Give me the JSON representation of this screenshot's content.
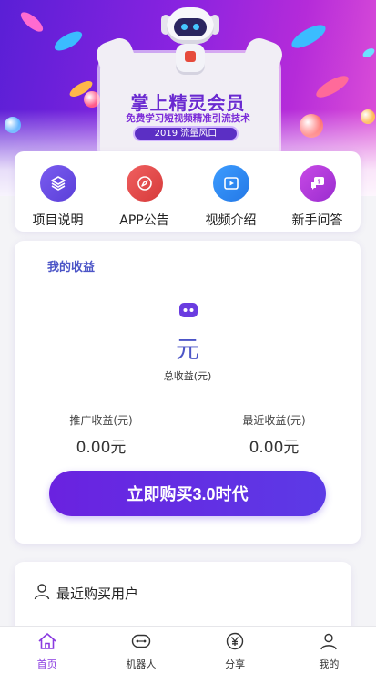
{
  "banner": {
    "title": "掌上精灵会员",
    "subtitle": "免费学习短视频精准引流技术",
    "pill": "2019 流量风口"
  },
  "menu": [
    {
      "label": "项目说明",
      "icon": "layers-icon",
      "color": "#6c4ce6"
    },
    {
      "label": "APP公告",
      "icon": "compass-icon",
      "color": "#e04848"
    },
    {
      "label": "视频介绍",
      "icon": "video-icon",
      "color": "#2b8af0"
    },
    {
      "label": "新手问答",
      "icon": "chat-question-icon",
      "color": "#b738d8"
    }
  ],
  "earnings": {
    "title": "我的收益",
    "icon": "robot-icon",
    "total_value": "元",
    "total_label": "总收益(元)",
    "promo_label": "推广收益(元)",
    "promo_value": "0.00元",
    "recent_label": "最近收益(元)",
    "recent_value": "0.00元",
    "buy_button": "立即购买3.0时代"
  },
  "recent_buyers": {
    "title": "最近购买用户",
    "icon": "user-icon"
  },
  "tabs": [
    {
      "label": "首页",
      "icon": "home-icon",
      "active": true
    },
    {
      "label": "机器人",
      "icon": "robot-face-icon",
      "active": false
    },
    {
      "label": "分享",
      "icon": "yen-icon",
      "active": false
    },
    {
      "label": "我的",
      "icon": "person-icon",
      "active": false
    }
  ],
  "colors": {
    "accent": "#5c3ae6",
    "title_blue": "#4c55c7",
    "tab_active": "#8a3be0"
  }
}
